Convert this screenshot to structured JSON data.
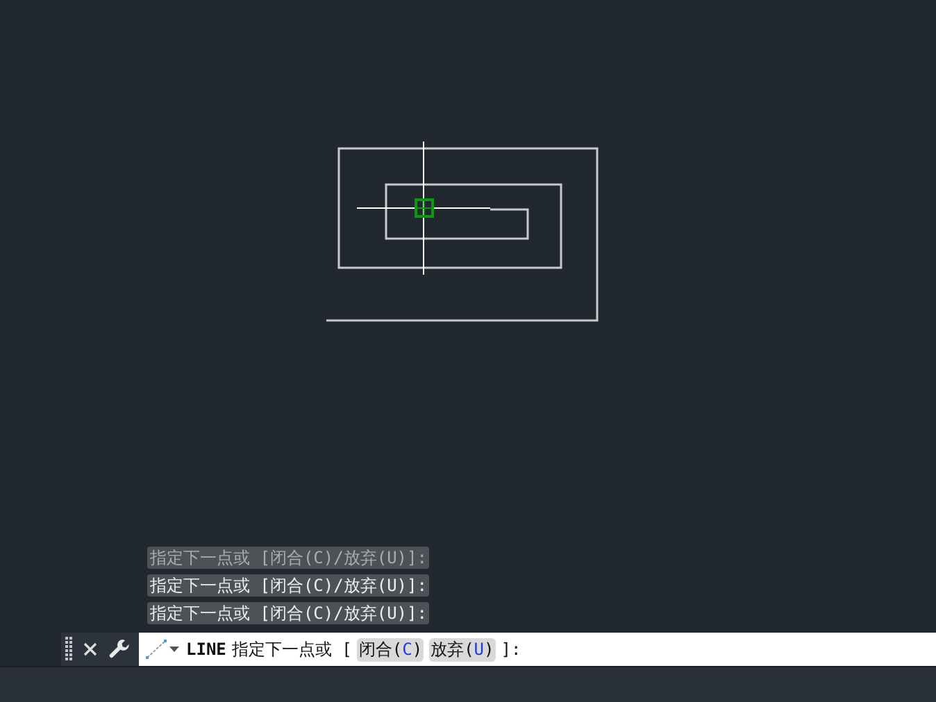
{
  "history": [
    {
      "text": "指定下一点或 [闭合(C)/放弃(U)]:",
      "dimmed": true
    },
    {
      "text": "指定下一点或 [闭合(C)/放弃(U)]:",
      "dimmed": false
    },
    {
      "text": "指定下一点或 [闭合(C)/放弃(U)]:",
      "dimmed": false
    }
  ],
  "command_line": {
    "command": "LINE",
    "prompt": "指定下一点或 [",
    "options": [
      {
        "before": "闭合(",
        "key": "C",
        "after": ")"
      },
      {
        "before": "放弃(",
        "key": "U",
        "after": ")"
      }
    ],
    "suffix": "]:"
  }
}
